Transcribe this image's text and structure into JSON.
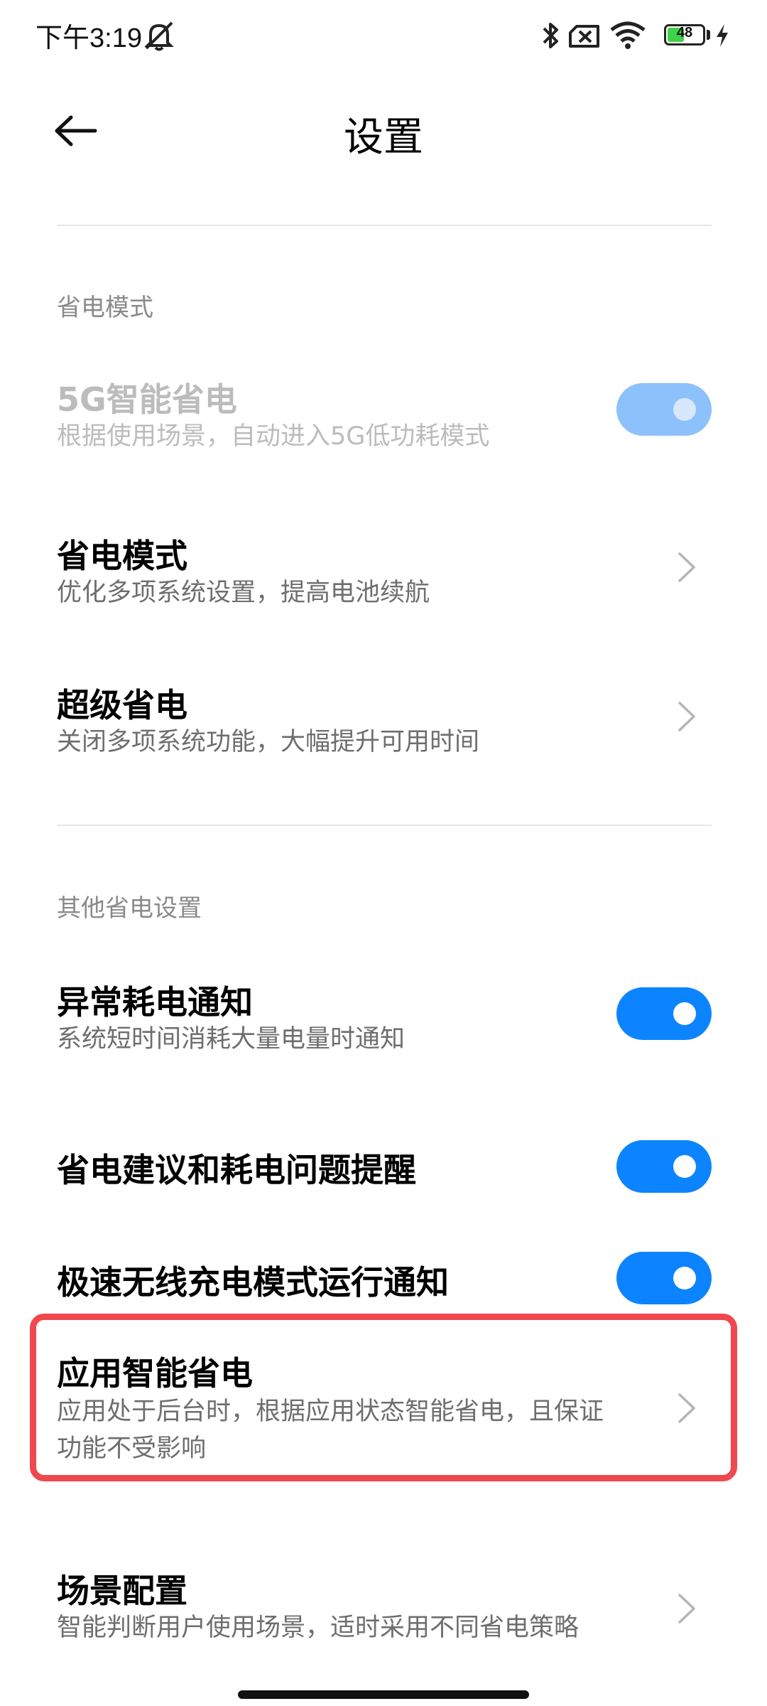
{
  "status_bar": {
    "time": "下午3:19",
    "battery_level": "48"
  },
  "header": {
    "title": "设置",
    "back_icon": "arrow-left-icon"
  },
  "sections": {
    "power_saving": {
      "header": "省电模式",
      "items": [
        {
          "title": "5G智能省电",
          "subtitle": "根据使用场景，自动进入5G低功耗模式",
          "control": "toggle",
          "state": "on",
          "enabled": false
        },
        {
          "title": "省电模式",
          "subtitle": "优化多项系统设置，提高电池续航",
          "control": "chevron"
        },
        {
          "title": "超级省电",
          "subtitle": "关闭多项系统功能，大幅提升可用时间",
          "control": "chevron"
        }
      ]
    },
    "other": {
      "header": "其他省电设置",
      "items": [
        {
          "title": "异常耗电通知",
          "subtitle": "系统短时间消耗大量电量时通知",
          "control": "toggle",
          "state": "on"
        },
        {
          "title": "省电建议和耗电问题提醒",
          "control": "toggle",
          "state": "on"
        },
        {
          "title": "极速无线充电模式运行通知",
          "control": "toggle",
          "state": "on"
        },
        {
          "title": "应用智能省电",
          "subtitle": "应用处于后台时，根据应用状态智能省电，且保证功能不受影响",
          "control": "chevron",
          "highlighted": true
        },
        {
          "title": "场景配置",
          "subtitle": "智能判断用户使用场景，适时采用不同省电策略",
          "control": "chevron"
        }
      ]
    }
  },
  "colors": {
    "accent": "#0d84ff",
    "accent_disabled": "#8dc1fb",
    "highlight": "#f0484f",
    "battery_fill": "#3fd14a"
  }
}
